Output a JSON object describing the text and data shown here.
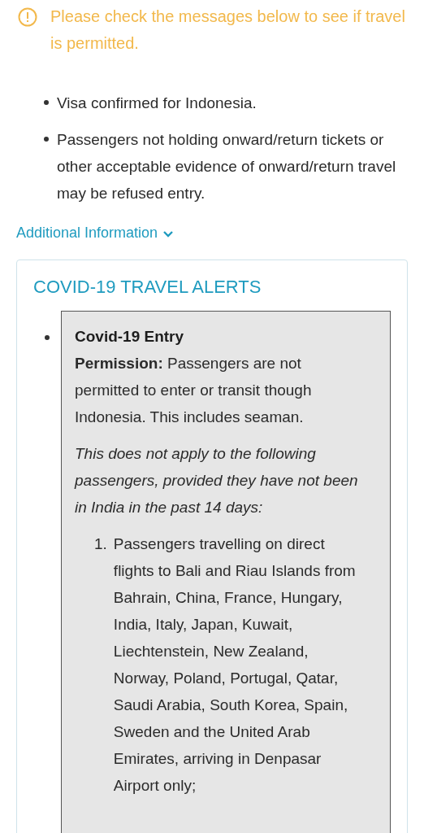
{
  "warning": {
    "message": "Please check the messages below to see if travel is permitted."
  },
  "messages": [
    "Visa confirmed for Indonesia.",
    "Passengers not holding onward/return tickets or other acceptable evidence of onward/return travel may be refused entry."
  ],
  "additional_info": {
    "label": "Additional Information",
    "expanded": false
  },
  "alerts_card": {
    "title": "COVID-19 TRAVEL ALERTS",
    "alert": {
      "heading": "Covid-19 Entry",
      "body": "**Permission:** Passengers are not permitted to enter or transit though Indonesia. This includes seaman.",
      "note": "This does not apply to the following passengers, provided they have not been in India in the past 14 days:",
      "exceptions": [
        {
          "number": "1.",
          "text": "Passengers travelling on direct flights to Bali and Riau Islands from Bahrain, China, France, Hungary, India, Italy, Japan, Kuwait, Liechtenstein, New Zealand, Norway, Poland, Portugal, Qatar, Saudi Arabia, South Korea, Spain, Sweden and the United Arab Emirates, arriving in Denpasar Airport only;"
        }
      ]
    }
  }
}
